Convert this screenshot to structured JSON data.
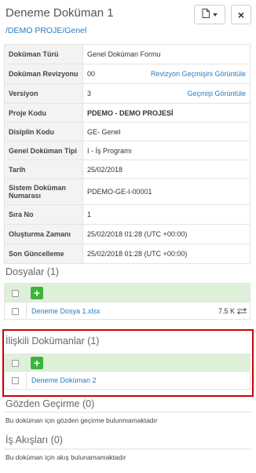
{
  "header": {
    "title": "Deneme Doküman 1",
    "breadcrumb": "/DEMO PROJE/Genel",
    "doc_button_icon": "file-icon",
    "close_label": "×"
  },
  "info_rows": [
    {
      "key": "Doküman Türü",
      "value": "Genel Doküman Formu",
      "link": ""
    },
    {
      "key": "Doküman Revizyonu",
      "value": "00",
      "link": "Revizyon Geçmişini Görüntüle"
    },
    {
      "key": "Versiyon",
      "value": "3",
      "link": "Geçmişi Görüntüle"
    },
    {
      "key": "Proje Kodu",
      "value": "PDEMO - DEMO PROJESİ",
      "link": ""
    },
    {
      "key": "Disiplin Kodu",
      "value": "GE- Genel",
      "link": ""
    },
    {
      "key": "Genel Doküman Tipi",
      "value": "I - İş Programı",
      "link": ""
    },
    {
      "key": "Tarih",
      "value": "25/02/2018",
      "link": ""
    },
    {
      "key": "Sistem Doküman Numarası",
      "value": "PDEMO-GE-I-00001",
      "link": ""
    },
    {
      "key": "Sıra No",
      "value": "1",
      "link": ""
    },
    {
      "key": "Oluşturma Zamanı",
      "value": "25/02/2018 01:28 (UTC +00:00)",
      "link": ""
    },
    {
      "key": "Son Güncelleme",
      "value": "25/02/2018 01:28 (UTC +00:00)",
      "link": ""
    }
  ],
  "files": {
    "title": "Dosyalar (1)",
    "add_label": "+",
    "items": [
      {
        "name": "Deneme Dosya 1.xlsx",
        "size": "7.5 K"
      }
    ]
  },
  "related": {
    "title": "İlişkili Dokümanlar (1)",
    "add_label": "+",
    "items": [
      {
        "name": "Deneme Doküman 2"
      }
    ]
  },
  "reviews": {
    "title": "Gözden Geçirme (0)",
    "empty": "Bu doküman için gözden geçirme bulunmamaktadır"
  },
  "workflows": {
    "title": "İş Akışları (0)",
    "empty": "Bu doküman için akış bulunamamaktadır"
  },
  "colors": {
    "accent": "#2a7bc1",
    "add_green": "#3cb43c",
    "add_row_bg": "#dff0d8",
    "highlight": "#cc0000"
  }
}
